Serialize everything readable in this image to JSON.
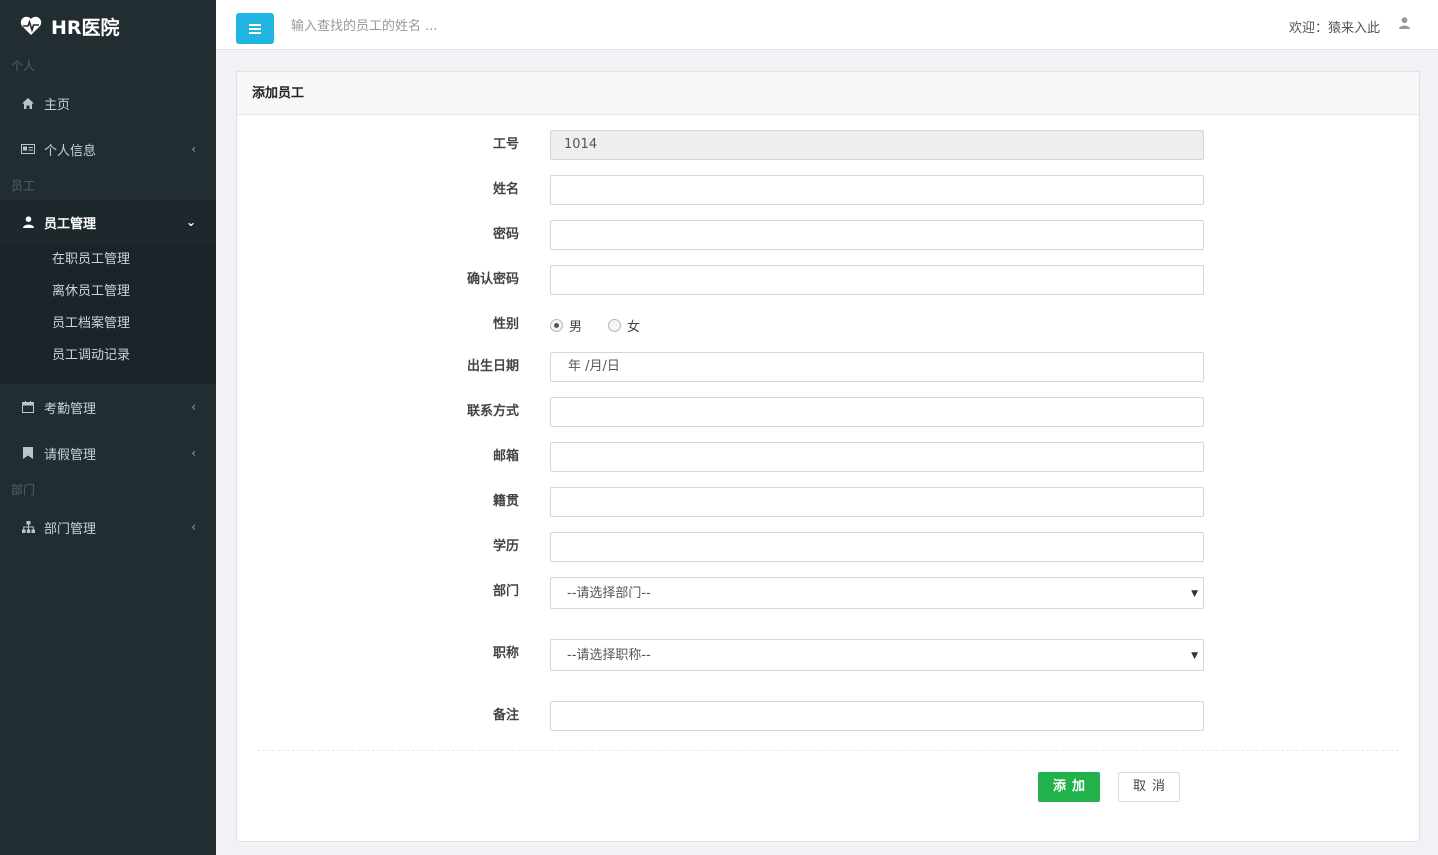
{
  "brand": {
    "title": "HR医院"
  },
  "sidebar": {
    "sections": [
      "个人",
      "员工",
      "部门"
    ],
    "items": [
      {
        "label": "主页",
        "icon": "home-icon"
      },
      {
        "label": "个人信息",
        "icon": "id-card-icon"
      },
      {
        "label": "员工管理",
        "icon": "user-icon"
      },
      {
        "label": "考勤管理",
        "icon": "calendar-icon"
      },
      {
        "label": "请假管理",
        "icon": "bookmark-icon"
      },
      {
        "label": "部门管理",
        "icon": "sitemap-icon"
      }
    ],
    "submenu": [
      "在职员工管理",
      "离休员工管理",
      "员工档案管理",
      "员工调动记录"
    ]
  },
  "topbar": {
    "search_placeholder": "输入查找的员工的姓名 ...",
    "welcome": "欢迎：猿来入此"
  },
  "panel": {
    "title": "添加员工"
  },
  "form": {
    "labels": {
      "id": "工号",
      "name": "姓名",
      "password": "密码",
      "confirm": "确认密码",
      "gender": "性别",
      "birth": "出生日期",
      "contact": "联系方式",
      "email": "邮箱",
      "native": "籍贯",
      "education": "学历",
      "department": "部门",
      "title": "职称",
      "remark": "备注"
    },
    "id_value": "1014",
    "gender_options": [
      "男",
      "女"
    ],
    "gender_selected": "男",
    "birth_placeholder": "年 /月/日",
    "department_selected": "--请选择部门--",
    "title_selected": "--请选择职称--",
    "submit": "添加",
    "cancel": "取消"
  },
  "colors": {
    "sidebar": "#222d32",
    "accent": "#1fb5e0",
    "submit": "#21b24b"
  }
}
